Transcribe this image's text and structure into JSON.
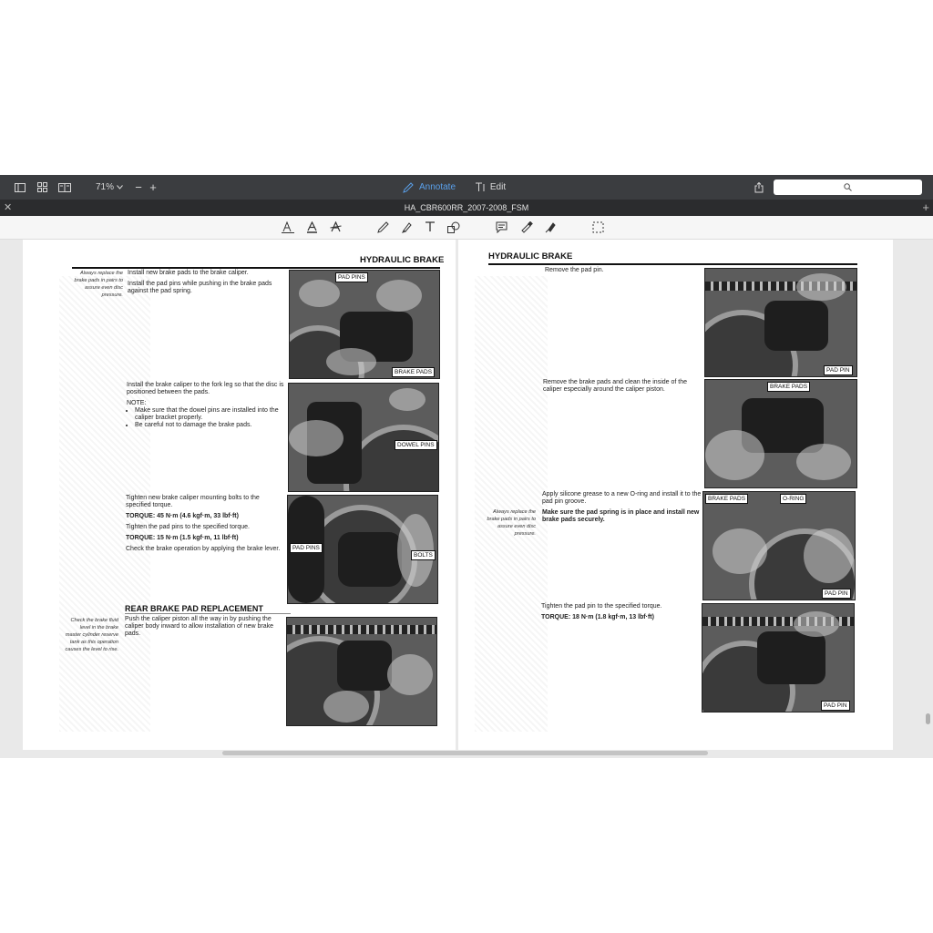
{
  "toolbar": {
    "zoom": "71%",
    "annotate_label": "Annotate",
    "edit_label": "Edit",
    "search_placeholder": ""
  },
  "tab": {
    "title": "HA_CBR600RR_2007-2008_FSM"
  },
  "colors": {
    "toolbar_bg": "#3b3d40",
    "tabbar_bg": "#2b2c2e",
    "accent": "#5aa0ea"
  },
  "left_page": {
    "heading": "HYDRAULIC BRAKE",
    "side_note_1": "Always replace the brake pads in pairs to assure even disc pressure.",
    "step1_line1": "Install new brake pads to the brake caliper.",
    "step1_line2": "Install the pad pins while pushing in the brake pads against the pad spring.",
    "photo1_label_a": "PAD PINS",
    "photo1_label_b": "BRAKE PADS",
    "step2_text": "Install the brake caliper to the fork leg so that the disc is positioned between the pads.",
    "note_label": "NOTE:",
    "note_bullets": [
      "Make sure that the dowel pins are installed into the caliper bracket properly.",
      "Be careful not to damage the brake pads."
    ],
    "photo2_label": "DOWEL PINS",
    "step3_text": "Tighten new brake caliper mounting bolts to the specified torque.",
    "torque1": "TORQUE: 45 N·m (4.6 kgf·m, 33 lbf·ft)",
    "step3_text_b": "Tighten the pad pins to the specified torque.",
    "torque2": "TORQUE: 15 N·m (1.5 kgf·m, 11 lbf·ft)",
    "step3_text_c": "Check the brake operation by applying the brake lever.",
    "photo3_label_a": "PAD PINS",
    "photo3_label_b": "BOLTS",
    "section_heading": "REAR BRAKE PAD REPLACEMENT",
    "side_note_2": "Check the brake fluid level in the brake master cylinder reserve tank as this operation causes the level to rise.",
    "step4_text": "Push the caliper piston all the way in by pushing the caliper body inward to allow installation of new brake pads."
  },
  "right_page": {
    "heading": "HYDRAULIC BRAKE",
    "step1_text": "Remove the pad pin.",
    "photo1_label": "PAD PIN",
    "step2_text": "Remove the brake pads and clean the inside of the caliper especially around the caliper piston.",
    "photo2_label": "BRAKE PADS",
    "side_note": "Always replace the brake pads in pairs to assure even disc pressure.",
    "step3_text": "Apply silicone grease to a new O-ring and install it to the pad pin groove.",
    "step3_text_b": "Make sure the pad spring is in place and install new brake pads securely.",
    "photo3_label_a": "BRAKE PADS",
    "photo3_label_b": "O-RING",
    "photo3_label_c": "PAD PIN",
    "step4_text": "Tighten the pad pin to the specified torque.",
    "torque": "TORQUE: 18 N·m (1.8 kgf·m, 13 lbf·ft)",
    "photo4_label": "PAD PIN"
  }
}
